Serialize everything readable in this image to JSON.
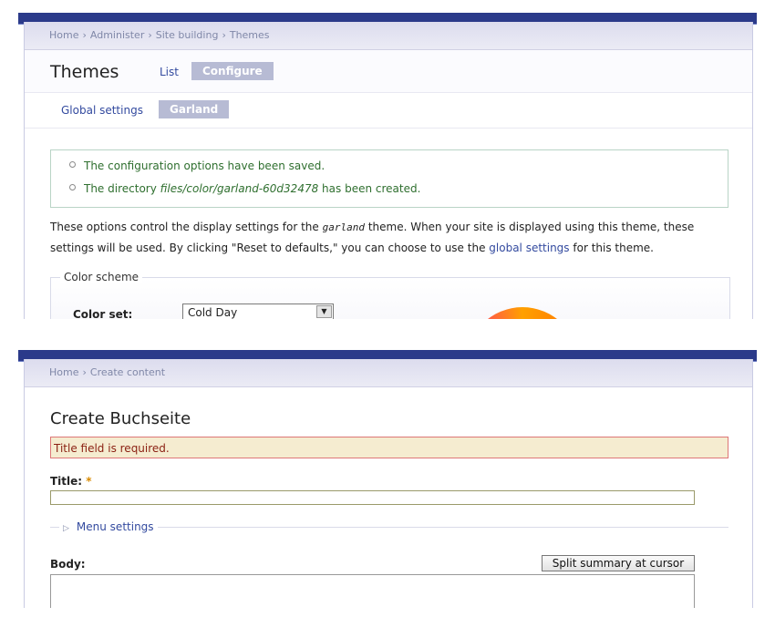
{
  "theme_screen": {
    "breadcrumb": [
      "Home",
      "Administer",
      "Site building",
      "Themes"
    ],
    "title": "Themes",
    "tabs": [
      "List",
      "Configure"
    ],
    "subtabs": [
      "Global settings",
      "Garland"
    ],
    "messages": {
      "saved": "The configuration options have been saved.",
      "dir_prefix": "The directory",
      "dir_path": "files/color/garland-60d32478",
      "dir_suffix": "has been created."
    },
    "intro": {
      "part1": "These options control the display settings for the",
      "theme_name": "garland",
      "part2": "theme. When your site is displayed using this theme, these settings will be used. By clicking \"Reset to defaults,\" you can choose to use the",
      "link": "global settings",
      "part3": "for this theme."
    },
    "color_scheme": {
      "legend": "Color scheme",
      "color_set_label": "Color set:",
      "color_set_value": "Cold Day"
    }
  },
  "create_screen": {
    "breadcrumb": [
      "Home",
      "Create content"
    ],
    "title": "Create Buchseite",
    "error": "Title field is required.",
    "title_label": "Title:",
    "required_marker": "*",
    "menu_settings": "Menu settings",
    "body_label": "Body:",
    "split_button": "Split summary at cursor"
  },
  "colors": {
    "header_bar": "#2b3a8a",
    "link": "#334a9f",
    "status_green": "#2f6f2f",
    "error_bg": "#f5ecd0",
    "error_text": "#8a1f11"
  }
}
